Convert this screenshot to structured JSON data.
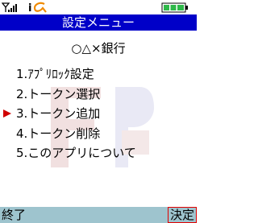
{
  "status": {
    "signal_icon": "signal-antenna-icon",
    "imode_icon": "i-alpha-icon",
    "battery_icon": "battery-icon"
  },
  "title": "設定メニュー",
  "bank_name": "○△×銀行",
  "menu": {
    "items": [
      {
        "label": "1.ｱﾌﾟﾘﾛｯｸ設定"
      },
      {
        "label": "2.トークン選択"
      },
      {
        "label": "3.トークン追加"
      },
      {
        "label": "4.トークン削除"
      },
      {
        "label": "5.このアプリについて"
      }
    ],
    "selected_index": 2
  },
  "softkeys": {
    "left": "終了",
    "right": "決定"
  },
  "colors": {
    "title_bg": "#0000c8",
    "softkey_bg": "#9ec4ce",
    "selection_arrow": "#d00000",
    "battery": "#2fb84a"
  }
}
